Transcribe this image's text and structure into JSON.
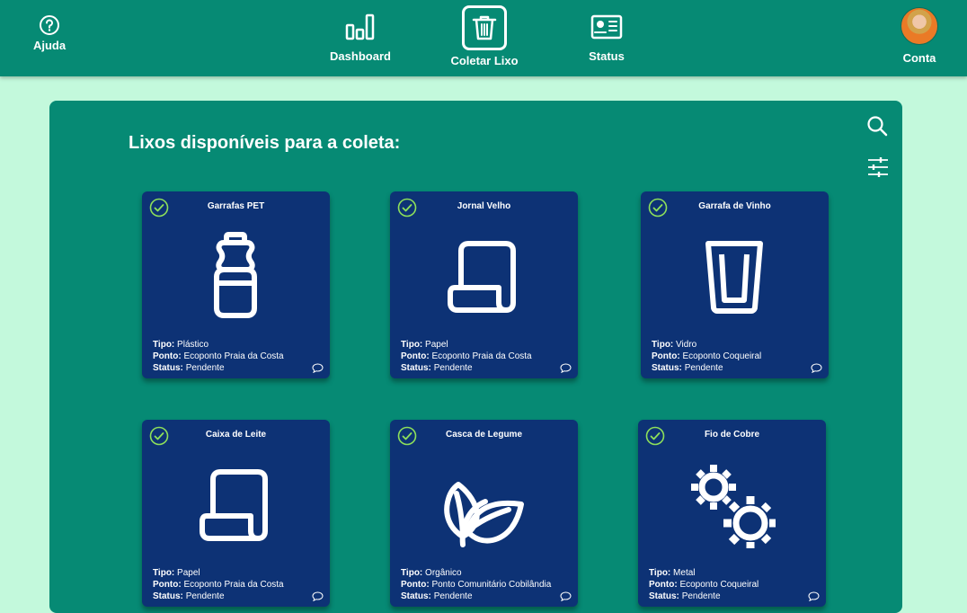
{
  "nav": {
    "help": "Ajuda",
    "dashboard": "Dashboard",
    "coletar": "Coletar Lixo",
    "status": "Status",
    "conta": "Conta"
  },
  "panel": {
    "title": "Lixos disponíveis para a coleta:"
  },
  "labels": {
    "tipo": "Tipo:",
    "ponto": "Ponto:",
    "status": "Status:"
  },
  "cards": [
    {
      "name": "Garrafas PET",
      "icon": "bottle-icon",
      "tipo": "Plástico",
      "ponto": "Ecoponto Praia da Costa",
      "status": "Pendente"
    },
    {
      "name": "Jornal Velho",
      "icon": "paper-icon",
      "tipo": "Papel",
      "ponto": "Ecoponto Praia da Costa",
      "status": "Pendente"
    },
    {
      "name": "Garrafa de Vinho",
      "icon": "glass-icon",
      "tipo": "Vidro",
      "ponto": "Ecoponto Coqueiral",
      "status": "Pendente"
    },
    {
      "name": "Caixa de Leite",
      "icon": "paper-icon",
      "tipo": "Papel",
      "ponto": "Ecoponto Praia da Costa",
      "status": "Pendente"
    },
    {
      "name": "Casca de Legume",
      "icon": "leaf-icon",
      "tipo": "Orgânico",
      "ponto": "Ponto Comunitário Cobilândia",
      "status": "Pendente"
    },
    {
      "name": "Fio de Cobre",
      "icon": "gears-icon",
      "tipo": "Metal",
      "ponto": "Ecoponto Coqueiral",
      "status": "Pendente"
    }
  ]
}
